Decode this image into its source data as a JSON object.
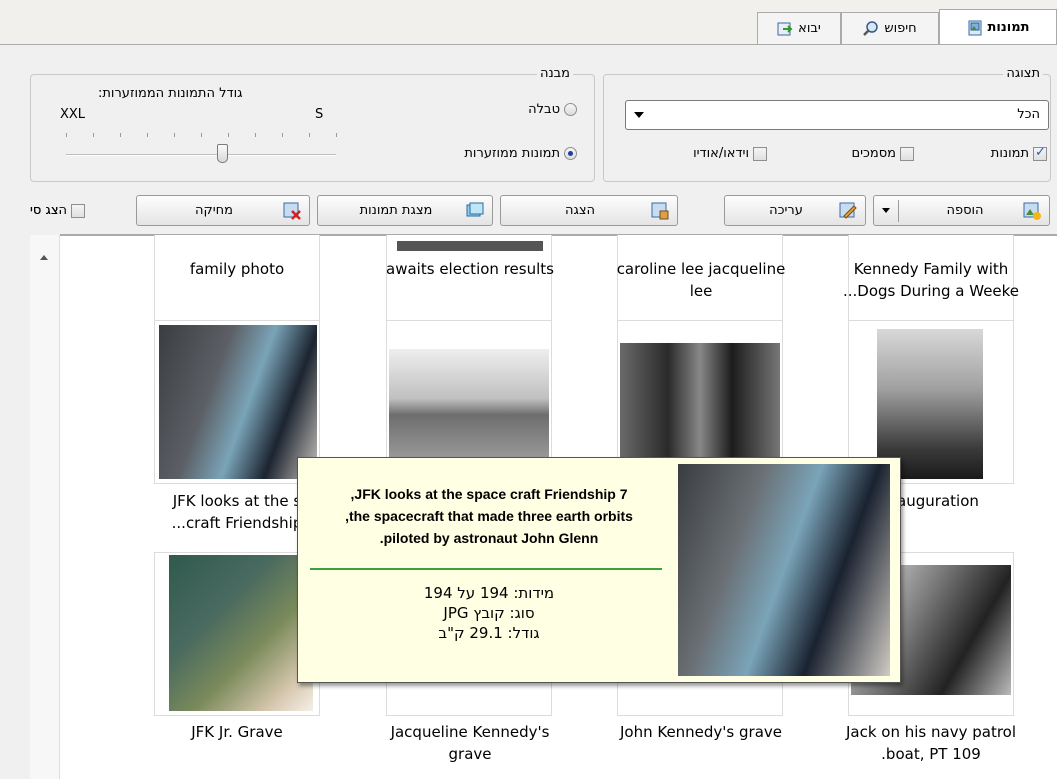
{
  "tabs": [
    {
      "label": "תמונות",
      "icon": "pictures-icon",
      "active": true
    },
    {
      "label": "חיפוש",
      "icon": "search-icon",
      "active": false
    },
    {
      "label": "יבוא",
      "icon": "import-icon",
      "active": false
    }
  ],
  "display_group": {
    "legend": "תצוגה",
    "combo_value": "הכל",
    "checkboxes": [
      {
        "label": "תמונות",
        "checked": true
      },
      {
        "label": "מסמכים",
        "checked": false
      },
      {
        "label": "וידאו/אודיו",
        "checked": false
      }
    ]
  },
  "structure_group": {
    "legend": "מבנה",
    "options": [
      {
        "label": "טבלה",
        "selected": false
      },
      {
        "label": "תמונות ממוזערות",
        "selected": true
      }
    ],
    "slider_title": "גודל התמונות הממוזערות:",
    "slider_min": "S",
    "slider_max": "XXL",
    "slider_level": 0.42
  },
  "toolbar": {
    "add": "הוספה",
    "edit": "עריכה",
    "show": "הצגה",
    "slideshow": "מצגת תמונות",
    "delete": "מחיקה",
    "show_toggle": "הצג סי"
  },
  "gallery": {
    "row1": [
      {
        "caption": "Kennedy Family with\nDogs During a Weeke..."
      },
      {
        "caption": "caroline lee jacqueline\nlee"
      },
      {
        "caption": "awaits election results"
      },
      {
        "caption": "family photo"
      }
    ],
    "row2": [
      {
        "caption": "Inauguration"
      },
      {
        "caption": ""
      },
      {
        "caption": ""
      },
      {
        "caption": "JFK looks at the s\ncraft Friendship..."
      }
    ],
    "row3": [
      {
        "caption": "Jack on his navy patrol\nboat, PT 109."
      },
      {
        "caption": "John Kennedy's grave"
      },
      {
        "caption": "Jacqueline Kennedy's\ngrave"
      },
      {
        "caption": "JFK Jr. Grave"
      }
    ]
  },
  "tooltip": {
    "title": "JFK looks at the space craft Friendship 7,\nthe spacecraft that made three earth orbits,\npiloted by astronaut John Glenn.",
    "dimensions": "מידות: 194 על 194",
    "type": "סוג: קובץ JPG",
    "size": "גודל: 29.1 ק\"ב"
  },
  "colors": {
    "accent_green": "#3aa23a",
    "tooltip_bg": "#ffffe4",
    "selection_blue": "#1e3f9a"
  }
}
